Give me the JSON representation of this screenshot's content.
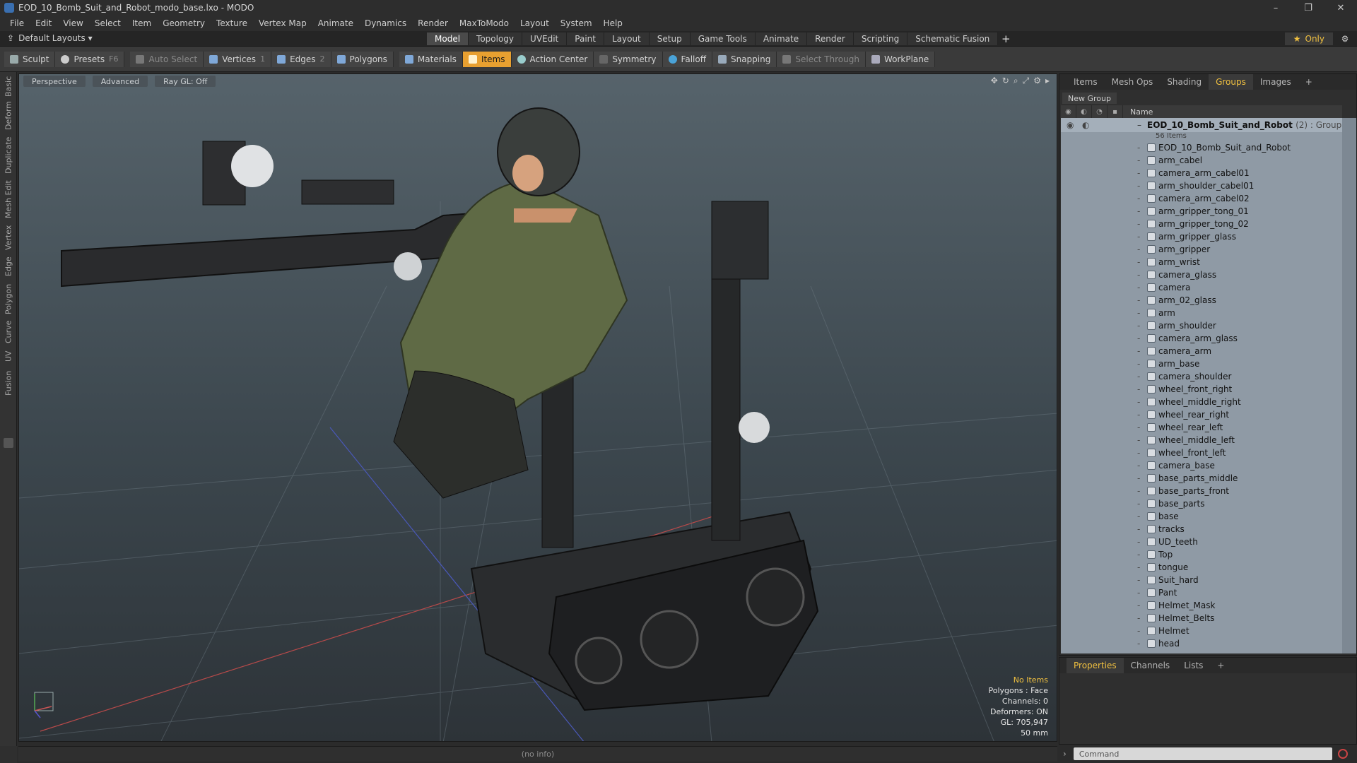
{
  "window": {
    "title": "EOD_10_Bomb_Suit_and_Robot_modo_base.lxo - MODO",
    "controls": [
      "–",
      "❐",
      "✕"
    ]
  },
  "menu": [
    "File",
    "Edit",
    "View",
    "Select",
    "Item",
    "Geometry",
    "Texture",
    "Vertex Map",
    "Animate",
    "Dynamics",
    "Render",
    "MaxToModo",
    "Layout",
    "System",
    "Help"
  ],
  "layout_selector": "Default Layouts ▾",
  "tabs": [
    "Model",
    "Topology",
    "UVEdit",
    "Paint",
    "Layout",
    "Setup",
    "Game Tools",
    "Animate",
    "Render",
    "Scripting",
    "Schematic Fusion"
  ],
  "active_tab": "Model",
  "only_label": "Only",
  "toolbar": {
    "sculpt": "Sculpt",
    "presets": "Presets",
    "presets_key": "F6",
    "auto_select": "Auto Select",
    "vertices": "Vertices",
    "vertices_key": "1",
    "edges": "Edges",
    "edges_key": "2",
    "polygons": "Polygons",
    "materials": "Materials",
    "items": "Items",
    "action_center": "Action Center",
    "symmetry": "Symmetry",
    "falloff": "Falloff",
    "snapping": "Snapping",
    "select_through": "Select Through",
    "workplane": "WorkPlane"
  },
  "left_tabs": [
    "Basic",
    "Deform",
    "Duplicate",
    "Mesh Edit",
    "Vertex",
    "Edge",
    "Polygon",
    "Curve",
    "UV",
    "Fusion"
  ],
  "viewport": {
    "view": "Perspective",
    "shading": "Advanced",
    "raygl": "Ray GL: Off",
    "stats": {
      "selection": "No Items",
      "polygons": "Polygons : Face",
      "channels": "Channels: 0",
      "deformers": "Deformers: ON",
      "gl": "GL: 705,947",
      "focal": "50 mm"
    }
  },
  "status_text": "(no info)",
  "right_panel": {
    "tabs": [
      "Items",
      "Mesh Ops",
      "Shading",
      "Groups",
      "Images"
    ],
    "active_tab": "Groups",
    "new_group": "New Group",
    "name_header": "Name",
    "group": {
      "name": "EOD_10_Bomb_Suit_and_Robot",
      "suffix": "(2) : Group",
      "count": "56 Items"
    },
    "items": [
      "EOD_10_Bomb_Suit_and_Robot",
      "arm_cabel",
      "camera_arm_cabel01",
      "arm_shoulder_cabel01",
      "camera_arm_cabel02",
      "arm_gripper_tong_01",
      "arm_gripper_tong_02",
      "arm_gripper_glass",
      "arm_gripper",
      "arm_wrist",
      "camera_glass",
      "camera",
      "arm_02_glass",
      "arm",
      "arm_shoulder",
      "camera_arm_glass",
      "camera_arm",
      "arm_base",
      "camera_shoulder",
      "wheel_front_right",
      "wheel_middle_right",
      "wheel_rear_right",
      "wheel_rear_left",
      "wheel_middle_left",
      "wheel_front_left",
      "camera_base",
      "base_parts_middle",
      "base_parts_front",
      "base_parts",
      "base",
      "tracks",
      "UD_teeth",
      "Top",
      "tongue",
      "Suit_hard",
      "Pant",
      "Helmet_Mask",
      "Helmet_Belts",
      "Helmet",
      "head"
    ]
  },
  "properties_panel": {
    "tabs": [
      "Properties",
      "Channels",
      "Lists"
    ],
    "active_tab": "Properties"
  },
  "command_placeholder": "Command"
}
